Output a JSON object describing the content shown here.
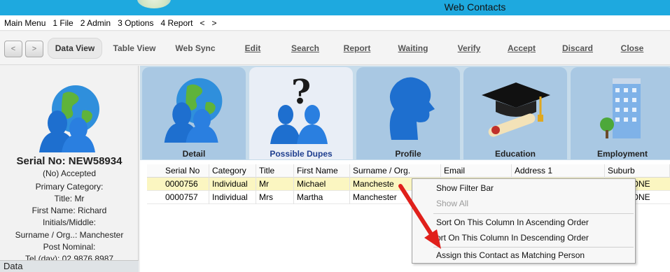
{
  "window": {
    "title": "Web Contacts"
  },
  "menu": {
    "items": [
      "Main Menu",
      "1 File",
      "2 Admin",
      "3 Options",
      "4 Report",
      "<",
      ">"
    ]
  },
  "toolbar": {
    "back": "<",
    "forward": ">",
    "buttons": [
      "Data View",
      "Table View",
      "Web Sync",
      "Edit",
      "Search",
      "Report",
      "Waiting",
      "Verify",
      "Accept",
      "Discard",
      "Close"
    ]
  },
  "record": {
    "serial": "Serial No: NEW58934",
    "lines": [
      "(No) Accepted",
      "Primary Category:",
      "Title: Mr",
      "First Name: Richard",
      "Initials/Middle:",
      "Surname / Org..: Manchester",
      "Post Nominal:",
      "Tel (day): 02 9876 8987"
    ],
    "footer_tab": "Data"
  },
  "tabs": [
    {
      "label": "Detail",
      "icon": "globe-people-icon"
    },
    {
      "label": "Possible Dupes",
      "icon": "question-people-icon"
    },
    {
      "label": "Profile",
      "icon": "head-profile-icon"
    },
    {
      "label": "Education",
      "icon": "graduation-cap-icon"
    },
    {
      "label": "Employment",
      "icon": "office-building-icon"
    }
  ],
  "grid": {
    "columns": [
      "Serial No",
      "Category",
      "Title",
      "First Name",
      "Surname / Org.",
      "Email",
      "Address 1",
      "Suburb"
    ],
    "rows": [
      [
        "0000756",
        "Individual",
        "Mr",
        "Michael",
        "Mancheste",
        "",
        "",
        "TH SYDNE"
      ],
      [
        "0000757",
        "Individual",
        "Mrs",
        "Martha",
        "Manchester",
        "",
        "",
        "TH SYDNE"
      ]
    ]
  },
  "context_menu": {
    "items": [
      {
        "label": "Show Filter Bar",
        "enabled": true
      },
      {
        "label": "Show All",
        "enabled": false
      },
      {
        "label": "Sort On This Column In Ascending Order",
        "enabled": true
      },
      {
        "label": "ort On This Column In Descending Order",
        "enabled": true
      },
      {
        "label": "Assign this Contact as Matching Person",
        "enabled": true
      }
    ]
  },
  "colors": {
    "titlebar": "#1ea9df",
    "tab_bg": "#a9c8e3",
    "selected_row": "#fbf6c1",
    "arrow": "#e0201b"
  }
}
